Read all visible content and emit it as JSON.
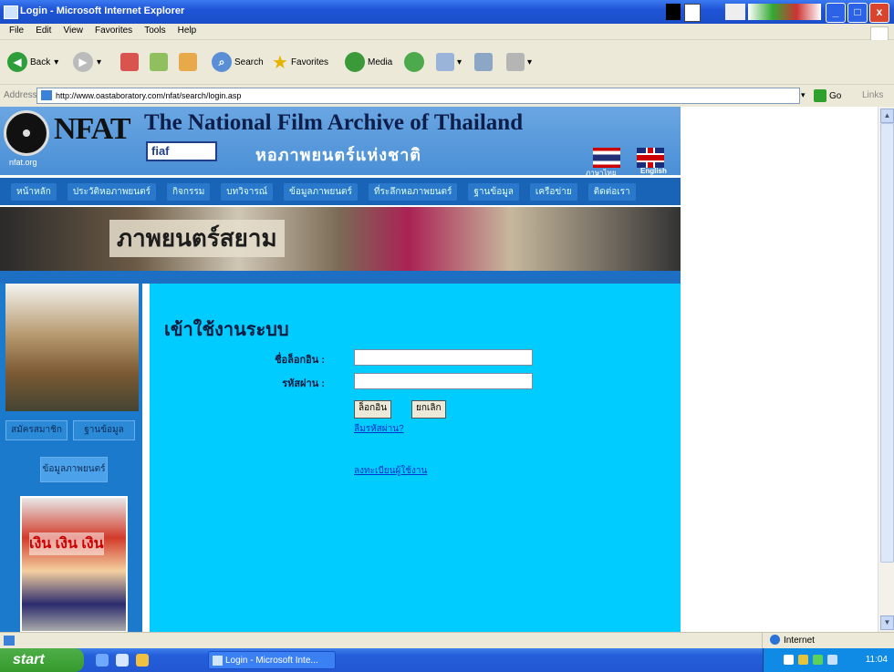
{
  "window": {
    "title": "Login - Microsoft Internet Explorer",
    "buttons": [
      "_",
      "□",
      "x"
    ]
  },
  "menu": [
    "File",
    "Edit",
    "View",
    "Favorites",
    "Tools",
    "Help"
  ],
  "toolbar": {
    "back": "Back",
    "search": "Search",
    "favorites": "Favorites",
    "media": "Media"
  },
  "address": {
    "label": "Address",
    "url": "http://www.oastaboratory.com/nfat/search/login.asp",
    "go": "Go",
    "links": "Links"
  },
  "site": {
    "logo_text": "NFAT",
    "logo_org": "nfat.org",
    "title": "The National Film Archive of Thailand",
    "fiaf": "fiaf",
    "thai_title": "หอภาพยนตร์แห่งชาติ",
    "lang_thai": "ภาษาไทย",
    "lang_english": "English",
    "nav": [
      "หน้าหลัก",
      "ประวัติหอภาพยนตร์",
      "กิจกรรม",
      "บทวิจารณ์",
      "ข้อมูลภาพยนตร์",
      "ที่ระลึกหอภาพยนตร์",
      "ฐานข้อมูล",
      "เครือข่าย",
      "ติดต่อเรา"
    ],
    "hero_title": "ภาพยนตร์สยาม",
    "left_buttons": [
      "สมัครสมาชิก",
      "ฐานข้อมูล"
    ],
    "left_highlight": "ข้อมูลภาพยนตร์",
    "poster_text": "เงิน เงิน เงิน"
  },
  "login": {
    "heading": "เข้าใช้งานระบบ",
    "username_label": "ชื่อล็อกอิน :",
    "password_label": "รหัสผ่าน :",
    "username_value": "",
    "password_value": "",
    "submit": "ล็อกอิน",
    "reset": "ยกเลิก",
    "forgot_link": "ลืมรหัสผ่าน?",
    "register_link": "ลงทะเบียนผู้ใช้งาน"
  },
  "status": {
    "zone": "Internet"
  },
  "taskbar": {
    "start": "start",
    "task": "Login - Microsoft Inte...",
    "clock": "11:04"
  },
  "colors": {
    "content_bg": "#00ccff",
    "nav_bg": "#1a64b8",
    "banner_bg": "#4a8fd6"
  }
}
